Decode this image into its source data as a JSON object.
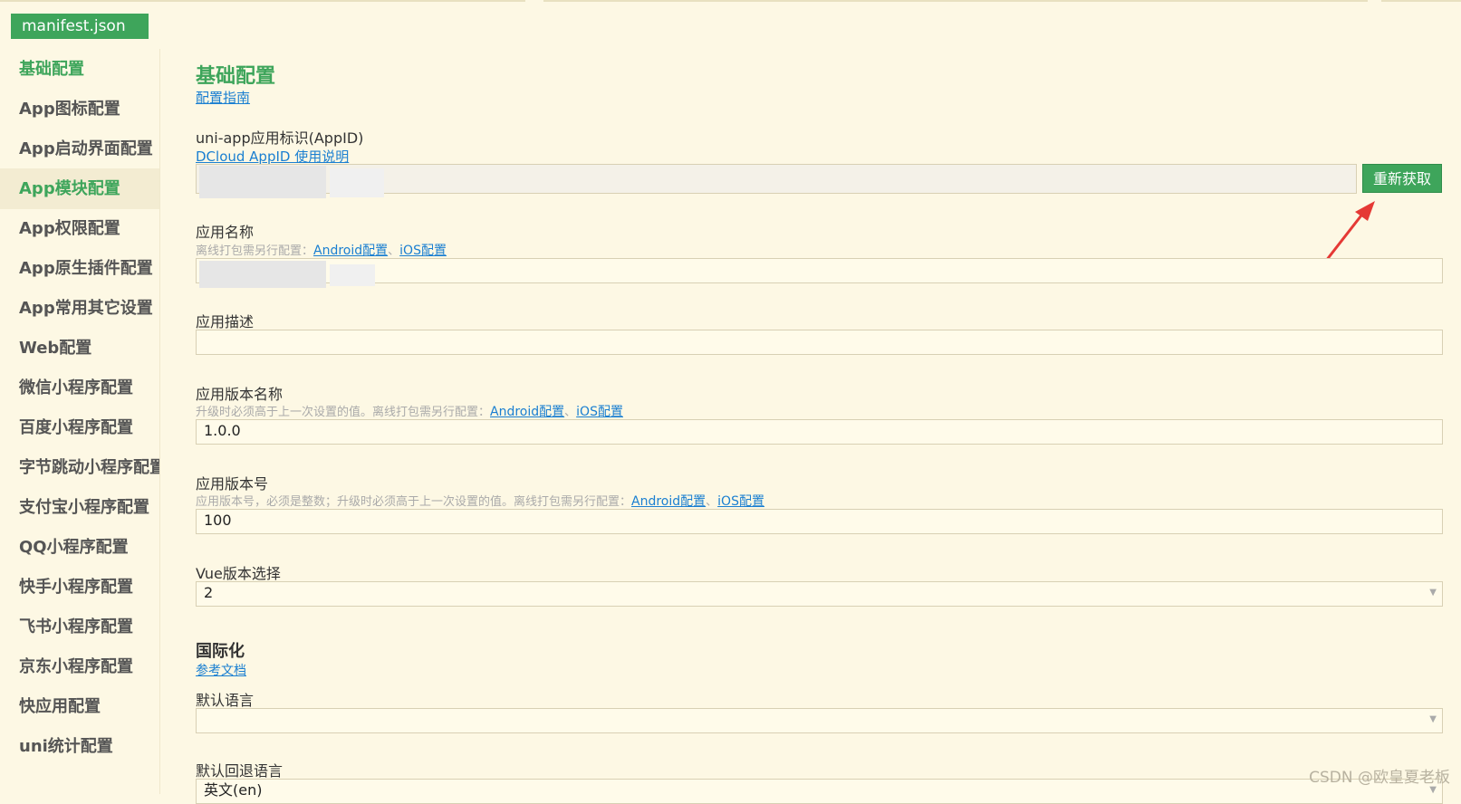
{
  "tab": {
    "filename": "manifest.json"
  },
  "sidebar": {
    "items": [
      {
        "label": "基础配置"
      },
      {
        "label": "App图标配置"
      },
      {
        "label": "App启动界面配置"
      },
      {
        "label": "App模块配置"
      },
      {
        "label": "App权限配置"
      },
      {
        "label": "App原生插件配置"
      },
      {
        "label": "App常用其它设置"
      },
      {
        "label": "Web配置"
      },
      {
        "label": "微信小程序配置"
      },
      {
        "label": "百度小程序配置"
      },
      {
        "label": "字节跳动小程序配置"
      },
      {
        "label": "支付宝小程序配置"
      },
      {
        "label": "QQ小程序配置"
      },
      {
        "label": "快手小程序配置"
      },
      {
        "label": "飞书小程序配置"
      },
      {
        "label": "京东小程序配置"
      },
      {
        "label": "快应用配置"
      },
      {
        "label": "uni统计配置"
      }
    ]
  },
  "main": {
    "title": "基础配置",
    "guide_link": "配置指南",
    "appid": {
      "label": "uni-app应用标识(AppID)",
      "link": "DCloud AppID 使用说明",
      "value": "",
      "button": "重新获取"
    },
    "app_name": {
      "label": "应用名称",
      "hint": "离线打包需另行配置：",
      "android_link": "Android配置",
      "sep": "、",
      "ios_link": "iOS配置",
      "value": ""
    },
    "app_desc": {
      "label": "应用描述",
      "value": ""
    },
    "version_name": {
      "label": "应用版本名称",
      "hint": "升级时必须高于上一次设置的值。离线打包需另行配置：",
      "android_link": "Android配置",
      "sep": "、",
      "ios_link": "iOS配置",
      "value": "1.0.0"
    },
    "version_code": {
      "label": "应用版本号",
      "hint": "应用版本号，必须是整数；升级时必须高于上一次设置的值。离线打包需另行配置：",
      "android_link": "Android配置",
      "sep": "、",
      "ios_link": "iOS配置",
      "value": "100"
    },
    "vue_version": {
      "label": "Vue版本选择",
      "value": "2"
    },
    "i18n": {
      "title": "国际化",
      "doc_link": "参考文档",
      "default_lang_label": "默认语言",
      "default_lang_value": "",
      "fallback_lang_label": "默认回退语言",
      "fallback_lang_value": "英文(en)"
    }
  },
  "watermark": "CSDN @欧皇夏老板",
  "colors": {
    "accent": "#3ea55b",
    "link": "#1a7fd1",
    "background": "#fdf8e4",
    "annotation_arrow": "#e53935"
  }
}
